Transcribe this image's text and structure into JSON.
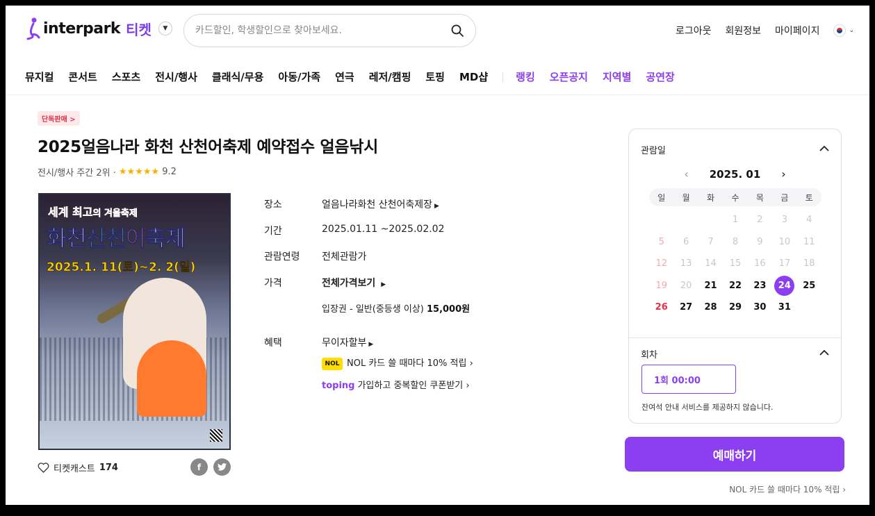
{
  "header": {
    "logo_text": "interpark",
    "logo_ticket": "티켓",
    "search_placeholder": "카드할인, 학생할인으로 찾아보세요.",
    "links": [
      "로그아웃",
      "회원정보",
      "마이페이지"
    ]
  },
  "nav": {
    "items": [
      "뮤지컬",
      "콘서트",
      "스포츠",
      "전시/행사",
      "클래식/무용",
      "아동/가족",
      "연극",
      "레저/캠핑",
      "토핑",
      "MD샵"
    ],
    "purple_items": [
      "랭킹",
      "오픈공지",
      "지역별",
      "공연장"
    ]
  },
  "product": {
    "badge": "단독판매 >",
    "title": "2025얼음나라 화천 산천어축제 예약접수 얼음낚시",
    "meta": "전시/행사 주간 2위 ·",
    "stars": "★★★★★",
    "score": "9.2",
    "rating": 9.2,
    "poster": {
      "line1_red": "세계 최고",
      "line1_white": "의 겨울축제",
      "line2_a": "화천",
      "line2_b": "산천",
      "line2_c": "어",
      "line2_d": "축제",
      "line3": "2025.1. 11(토)~2. 2(일)"
    },
    "ticketcast_label": "티켓캐스트",
    "ticketcast_count": "174"
  },
  "info": {
    "venue_label": "장소",
    "venue_value": "얼음나라화천 산천어축제장",
    "period_label": "기간",
    "period_value": "2025.01.11 ~2025.02.02",
    "age_label": "관람연령",
    "age_value": "전체관람가",
    "price_label": "가격",
    "price_all": "전체가격보기",
    "price_detail": "입장권 - 일반(중등생 이상)",
    "price_amount": "15,000원",
    "benefit_label": "혜택",
    "benefit_installment": "무이자할부",
    "benefit_nol": "NOL 카드 쓸 때마다 10% 적립",
    "benefit_toping_brand": "toping",
    "benefit_toping": "가입하고 중복할인 쿠폰받기"
  },
  "calendar": {
    "heading": "관람일",
    "month": "2025. 01",
    "weekdays": [
      "일",
      "월",
      "화",
      "수",
      "목",
      "금",
      "토"
    ],
    "selected_day": 24,
    "session_heading": "회차",
    "session_value": "1회 00:00",
    "notice": "잔여석 안내 서비스를 제공하지 않습니다."
  },
  "booking": {
    "button": "예매하기",
    "note": "NOL 카드 쓸 때마다 10% 적립"
  },
  "colors": {
    "accent": "#8b3ff0",
    "sunday": "#e5304a"
  }
}
